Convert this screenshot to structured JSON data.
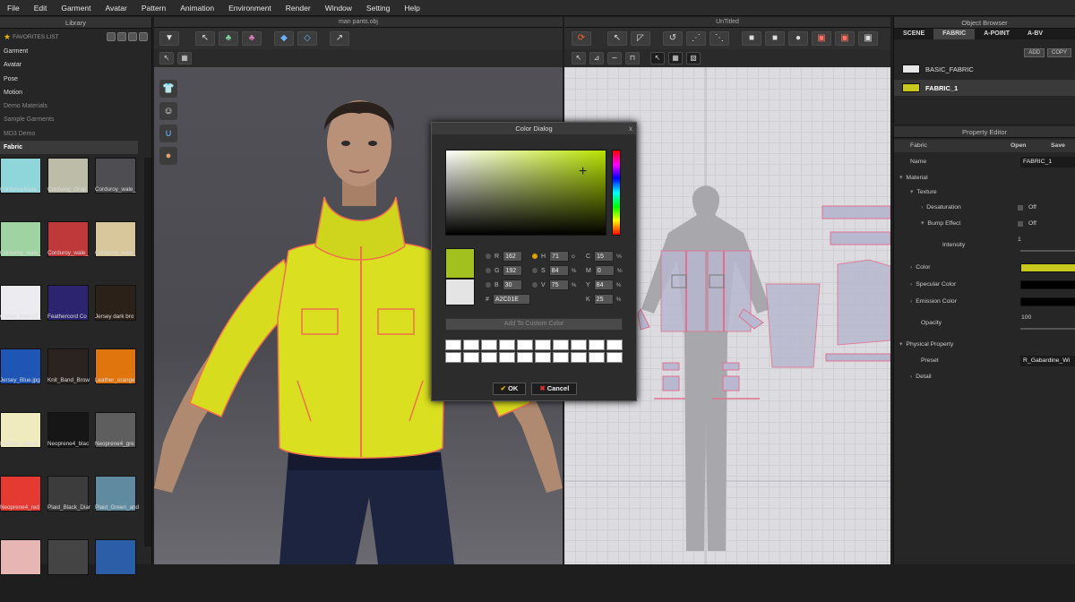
{
  "menu": [
    "File",
    "Edit",
    "Garment",
    "Avatar",
    "Pattern",
    "Animation",
    "Environment",
    "Render",
    "Window",
    "Setting",
    "Help"
  ],
  "library": {
    "title": "Library",
    "favorites_label": "FAVORITES LIST",
    "items": [
      {
        "label": "Garment",
        "dim": false
      },
      {
        "label": "Avatar",
        "dim": false
      },
      {
        "label": "Pose",
        "dim": false
      },
      {
        "label": "Motion",
        "dim": false
      },
      {
        "label": "Demo Materials",
        "dim": true
      },
      {
        "label": "Sample Garments",
        "dim": true
      },
      {
        "label": "MD3 Demo",
        "dim": true
      },
      {
        "label": "Fabric",
        "dim": false,
        "selected": true
      }
    ],
    "swatches": [
      {
        "label": "CorduroyAqua_",
        "color": "#8ed6da"
      },
      {
        "label": "Corduroy_Grap",
        "color": "#bdbca9"
      },
      {
        "label": "Corduroy_wale_",
        "color": "#4d4d52"
      },
      {
        "label": "Corduroy_wale_",
        "color": "#9fd3a2"
      },
      {
        "label": "Corduroy_wale_",
        "color": "#c0393a"
      },
      {
        "label": "Corduroy_wale_",
        "color": "#d8c79a"
      },
      {
        "label": "Cotton_linen31_",
        "color": "#ececf0"
      },
      {
        "label": "Feathercord Co",
        "color": "#2d2470"
      },
      {
        "label": "Jersey dark bro",
        "color": "#2c2118"
      },
      {
        "label": "Jersey_Blue.jpg",
        "color": "#1f55b5"
      },
      {
        "label": "Knit_Band_Brow",
        "color": "#2a2320"
      },
      {
        "label": "Leather_orange",
        "color": "#e0750e"
      },
      {
        "label": "Leather_yellow",
        "color": "#f0ebbf"
      },
      {
        "label": "Neoprene4_blac",
        "color": "#161616"
      },
      {
        "label": "Neoprene4_gre",
        "color": "#5e5e5e"
      },
      {
        "label": "Neoprene4_red",
        "color": "#e53a32"
      },
      {
        "label": "Plaid_Black_Diar",
        "color": "#3c3c3c"
      },
      {
        "label": "Plaid_Green_and",
        "color": "#5f8aa0"
      },
      {
        "label": "",
        "color": "#e8b5b5"
      },
      {
        "label": "",
        "color": "#444"
      },
      {
        "label": "",
        "color": "#2a5fa8"
      }
    ]
  },
  "viewport3d": {
    "title": "man pants.obj"
  },
  "viewport2d": {
    "title": "UnTitled"
  },
  "color_dialog": {
    "title": "Color Dialog",
    "close": "x",
    "new_color": "#A2C01E",
    "old_color": "#E4E4E4",
    "rgb": [
      {
        "label": "R",
        "value": "162"
      },
      {
        "label": "G",
        "value": "192"
      },
      {
        "label": "B",
        "value": "30"
      }
    ],
    "hsv": [
      {
        "label": "H",
        "value": "71",
        "unit": "o"
      },
      {
        "label": "S",
        "value": "84",
        "unit": "%"
      },
      {
        "label": "V",
        "value": "75",
        "unit": "%"
      }
    ],
    "cmyk": [
      {
        "label": "C",
        "value": "15",
        "unit": "%"
      },
      {
        "label": "M",
        "value": "0",
        "unit": "%"
      },
      {
        "label": "Y",
        "value": "84",
        "unit": "%"
      },
      {
        "label": "K",
        "value": "25",
        "unit": "%"
      }
    ],
    "hex_label": "#",
    "hex": "A2C01E",
    "add_custom_label": "Add To Custom Color",
    "ok_label": "OK",
    "cancel_label": "Cancel"
  },
  "object_browser": {
    "title": "Object Browser",
    "tabs": [
      "SCENE",
      "FABRIC",
      "A-POINT",
      "A-BV"
    ],
    "active_tab": "FABRIC",
    "add_label": "ADD",
    "copy_label": "COPY",
    "fabrics": [
      {
        "name": "BASIC_FABRIC",
        "color": "#e6e6e6"
      },
      {
        "name": "FABRIC_1",
        "color": "#c8c81e",
        "selected": true
      }
    ]
  },
  "property_editor": {
    "title": "Property Editor",
    "fabric_label": "Fabric",
    "open_label": "Open",
    "save_label": "Save",
    "name_label": "Name",
    "name_value": "FABRIC_1",
    "material_label": "Material",
    "texture_label": "Texture",
    "desaturation_label": "Desaturation",
    "desaturation_value": "Off",
    "bump_label": "Bump Effect",
    "bump_value": "Off",
    "intensity_label": "Intensity",
    "intensity_value": "1",
    "color_label": "Color",
    "color_value": "#c8c81e",
    "specular_label": "Specular Color",
    "specular_value": "#000000",
    "emission_label": "Emission Color",
    "emission_value": "#000000",
    "opacity_label": "Opacity",
    "opacity_value": "100",
    "physical_label": "Physical Property",
    "preset_label": "Preset",
    "preset_value": "R_Gabardine_Wi",
    "detail_label": "Detail"
  }
}
